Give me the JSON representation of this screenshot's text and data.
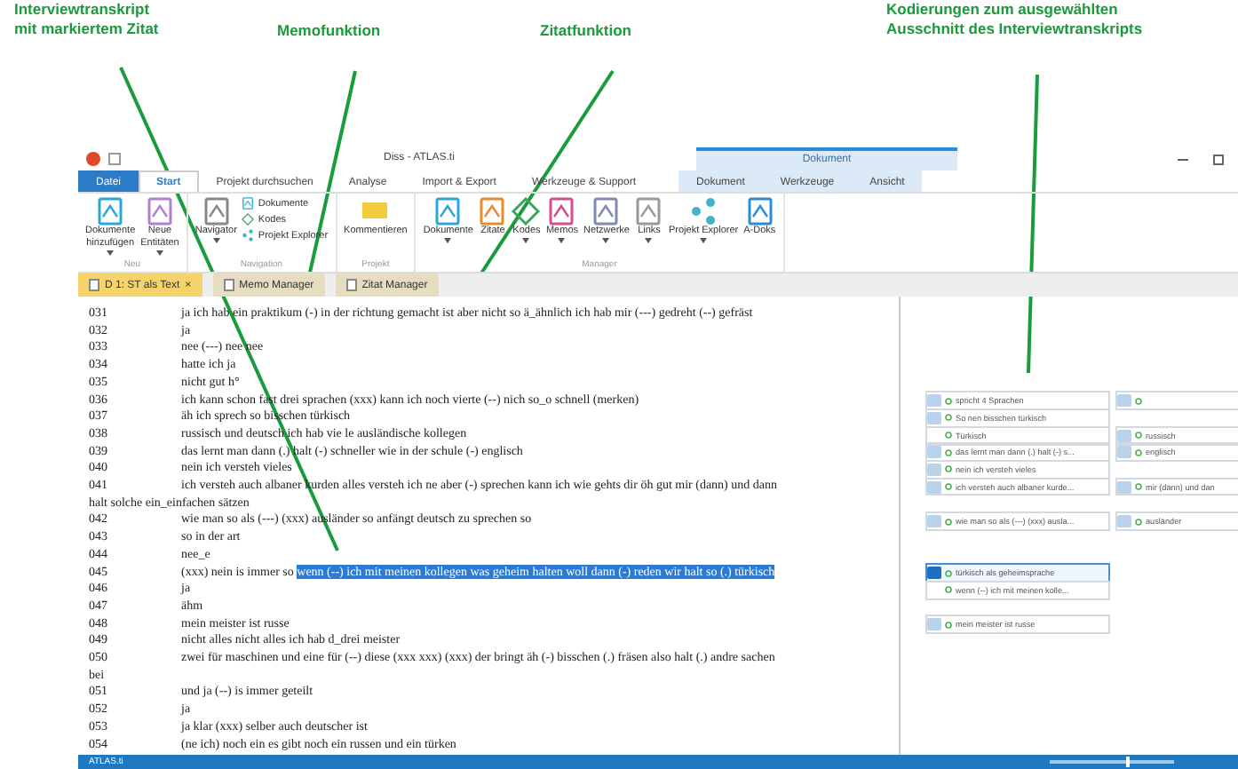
{
  "annotations": [
    {
      "text": "Interviewtranskript\nmit markiertem Zitat"
    },
    {
      "text": "Memofunktion"
    },
    {
      "text": "Zitatfunktion"
    },
    {
      "text": "Kodierungen zum ausgewählten\nAusschnitt des Interviewtranskripts"
    }
  ],
  "window": {
    "title": "Diss - ATLAS.ti",
    "context_group": "Dokument"
  },
  "ribbon_tabs": [
    {
      "label": "Datei",
      "kind": "file",
      "selected": false
    },
    {
      "label": "Start",
      "kind": "tab",
      "selected": true
    },
    {
      "label": "Projekt durchsuchen",
      "kind": "tab",
      "selected": false
    },
    {
      "label": "Analyse",
      "kind": "tab",
      "selected": false
    },
    {
      "label": "Import & Export",
      "kind": "tab",
      "selected": false
    },
    {
      "label": "Werkzeuge & Support",
      "kind": "tab",
      "selected": false
    },
    {
      "label": "Dokument",
      "kind": "context",
      "selected": false
    },
    {
      "label": "Werkzeuge",
      "kind": "context",
      "selected": false
    },
    {
      "label": "Ansicht",
      "kind": "context",
      "selected": false
    }
  ],
  "ribbon_groups": [
    {
      "label": "Neu",
      "buttons": [
        {
          "label": "Dokumente\nhinzufügen",
          "kind": "document",
          "dropdown": true
        },
        {
          "label": "Neue\nEntitäten",
          "kind": "entities",
          "dropdown": true
        }
      ]
    },
    {
      "label": "Navigation",
      "buttons": [
        {
          "label": "Navigator",
          "kind": "navigator",
          "dropdown": true
        }
      ],
      "small": [
        {
          "label": "Dokumente",
          "kind": "document"
        },
        {
          "label": "Kodes",
          "kind": "codes"
        },
        {
          "label": "Projekt Explorer",
          "kind": "explorer"
        }
      ]
    },
    {
      "label": "Projekt",
      "buttons": [
        {
          "label": "Kommentieren",
          "kind": "comment",
          "dropdown": false
        }
      ]
    },
    {
      "label": "Manager",
      "buttons": [
        {
          "label": "Dokumente",
          "kind": "document",
          "dropdown": true
        },
        {
          "label": "Zitate",
          "kind": "quotes",
          "dropdown": false
        },
        {
          "label": "Kodes",
          "kind": "codes",
          "dropdown": true
        },
        {
          "label": "Memos",
          "kind": "memos",
          "dropdown": true
        },
        {
          "label": "Netzwerke",
          "kind": "networks",
          "dropdown": true
        },
        {
          "label": "Links",
          "kind": "links",
          "dropdown": true
        },
        {
          "label": "Projekt Explorer",
          "kind": "explorer",
          "dropdown": true
        },
        {
          "label": "A-Doks",
          "kind": "adocs",
          "dropdown": false
        }
      ]
    }
  ],
  "doc_tabs": [
    {
      "label": "D 1: ST als Text",
      "close": "×",
      "selected": true
    },
    {
      "label": "Memo Manager",
      "selected": false
    },
    {
      "label": "Zitat Manager",
      "selected": false
    }
  ],
  "transcript": [
    {
      "number": "031",
      "text": "ja ich hab ein praktikum (-) in der richtung gemacht ist aber nicht so ä_ähnlich ich hab mir (---) gedreht (--) gefräst"
    },
    {
      "number": "032",
      "text": "ja"
    },
    {
      "number": "033",
      "text": "nee (---) nee nee"
    },
    {
      "number": "034",
      "text": "hatte ich ja"
    },
    {
      "number": "035",
      "text": "nicht gut h°"
    },
    {
      "number": "036",
      "text": "ich kann schon fast drei sprachen (xxx) kann ich noch vierte (--) nich so_o schnell (merken)",
      "left": {
        "label": "spricht 4 Sprachen",
        "selected": false,
        "quote": true
      },
      "right": {
        "selected": false,
        "quote": true
      }
    },
    {
      "number": "037",
      "text": "äh ich sprech so bisschen türkisch",
      "left": {
        "label": "So nen bisschen türkisch",
        "selected": false,
        "quote": true
      }
    },
    {
      "number": "038",
      "text": "russisch und deutsch ich hab vie le ausländische kollegen",
      "left": {
        "label": "Türkisch",
        "selected": false,
        "quote": false
      },
      "right": {
        "label": "russisch",
        "selected": false,
        "quote": true
      }
    },
    {
      "number": "039",
      "text": "das lernt man dann (.) halt (-) schneller wie in der schule (-) englisch",
      "left": {
        "label": "das lernt man dann (.) halt (-) s...",
        "selected": false,
        "quote": true
      },
      "right": {
        "label": "englisch",
        "selected": false,
        "quote": true
      }
    },
    {
      "number": "040",
      "text": "nein ich versteh vieles",
      "left": {
        "label": "nein ich versteh vieles",
        "selected": false,
        "quote": true
      }
    },
    {
      "number": "041",
      "text": "ich versteh auch albaner kurden alles versteh ich ne aber (-) sprechen kann ich wie gehts dir öh gut mir (dann) und dann",
      "wrap": "halt solche ein_einfachen sätzen",
      "left": {
        "label": "ich versteh auch albaner kurde...",
        "selected": false,
        "quote": true
      },
      "right": {
        "label": "mir (dann) und dan",
        "selected": false,
        "quote": true
      }
    },
    {
      "number": "042",
      "text": "wie man so als (---) (xxx) ausländer so anfängt deutsch zu sprechen so",
      "left": {
        "label": "wie man so als (---) (xxx) ausla...",
        "selected": false,
        "quote": true
      },
      "right": {
        "label": "ausländer",
        "selected": false,
        "quote": true
      }
    },
    {
      "number": "043",
      "text": "so in der art"
    },
    {
      "number": "044",
      "text": "nee_e"
    },
    {
      "number": "045",
      "text": "(xxx) nein is immer so ",
      "highlight": "wenn (--) ich mit meinen kollegen was geheim halten woll dann (-) reden wir halt so (.) türkisch",
      "left": {
        "label": "türkisch als geheimsprache",
        "selected": true,
        "quote": true
      }
    },
    {
      "number": "046",
      "text": "ja",
      "left": {
        "label": "wenn (--) ich mit meinen kolle...",
        "selected": false,
        "quote": false
      }
    },
    {
      "number": "047",
      "text": "ähm"
    },
    {
      "number": "048",
      "text": "mein meister ist russe",
      "left": {
        "label": "mein meister ist russe",
        "selected": false,
        "quote": true
      }
    },
    {
      "number": "049",
      "text": "nicht alles nicht alles ich hab d_drei meister"
    },
    {
      "number": "050",
      "text": "zwei für maschinen und eine für (--) diese (xxx xxx) (xxx) der bringt äh (-) bisschen (.) fräsen also halt (.) andre sachen",
      "wrap": "bei"
    },
    {
      "number": "051",
      "text": "und ja (--) is immer geteilt"
    },
    {
      "number": "052",
      "text": "ja"
    },
    {
      "number": "053",
      "text": "ja klar (xxx) selber auch deutscher ist"
    },
    {
      "number": "054",
      "text": "(ne ich) noch ein es gibt noch ein russen und ein türken"
    }
  ],
  "status_bar": {
    "text": "ATLAS.ti",
    "zoom": {
      "level": 0.62
    }
  }
}
